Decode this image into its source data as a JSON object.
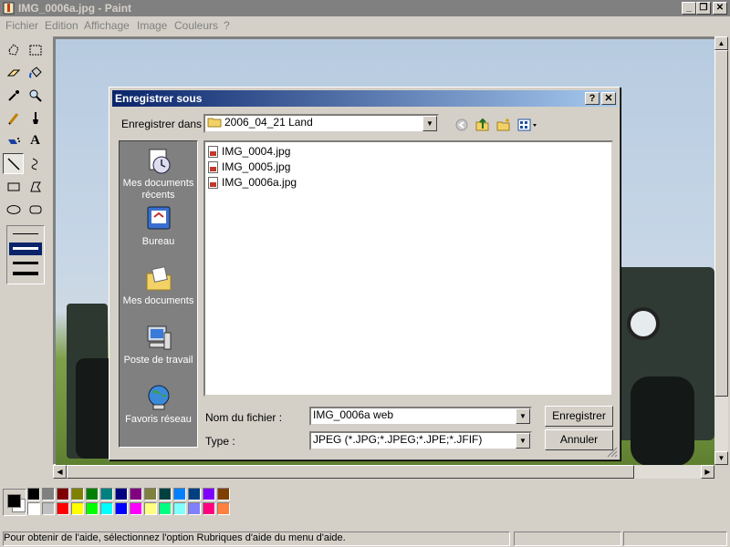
{
  "window": {
    "title": "IMG_0006a.jpg - Paint"
  },
  "menu": [
    "Fichier",
    "Edition",
    "Affichage",
    "Image",
    "Couleurs",
    "?"
  ],
  "toolbox": {
    "tools": [
      "free-select",
      "rect-select",
      "eraser",
      "fill",
      "color-picker",
      "magnifier",
      "pencil",
      "brush",
      "airbrush",
      "text",
      "line",
      "curve",
      "rectangle",
      "polygon",
      "ellipse",
      "rounded-rectangle"
    ],
    "selected": "line"
  },
  "palette": {
    "foreground": "#000000",
    "background": "#ffffff",
    "colors_row1": [
      "#000000",
      "#808080",
      "#800000",
      "#808000",
      "#008000",
      "#008080",
      "#000080",
      "#800080",
      "#808040",
      "#004040",
      "#0080ff",
      "#004080",
      "#8000ff",
      "#804000"
    ],
    "colors_row2": [
      "#ffffff",
      "#c0c0c0",
      "#ff0000",
      "#ffff00",
      "#00ff00",
      "#00ffff",
      "#0000ff",
      "#ff00ff",
      "#ffff80",
      "#00ff80",
      "#80ffff",
      "#8080ff",
      "#ff0080",
      "#ff8040"
    ]
  },
  "status": {
    "text": "Pour obtenir de l'aide, sélectionnez l'option Rubriques d'aide du menu d'aide."
  },
  "dialog": {
    "title": "Enregistrer sous",
    "help_button": "?",
    "close_button": "✕",
    "save_in_label": "Enregistrer dans :",
    "save_in_value": "2006_04_21 Land",
    "places": [
      {
        "label": "Mes documents récents",
        "icon": "recent-documents-icon"
      },
      {
        "label": "Bureau",
        "icon": "desktop-icon"
      },
      {
        "label": "Mes documents",
        "icon": "my-documents-icon"
      },
      {
        "label": "Poste de travail",
        "icon": "my-computer-icon"
      },
      {
        "label": "Favoris réseau",
        "icon": "network-places-icon"
      }
    ],
    "files": [
      "IMG_0004.jpg",
      "IMG_0005.jpg",
      "IMG_0006a.jpg"
    ],
    "filename_label": "Nom du fichier :",
    "filename_value": "IMG_0006a web",
    "type_label": "Type :",
    "type_value": "JPEG (*.JPG;*.JPEG;*.JPE;*.JFIF)",
    "save_button": "Enregistrer",
    "cancel_button": "Annuler"
  }
}
